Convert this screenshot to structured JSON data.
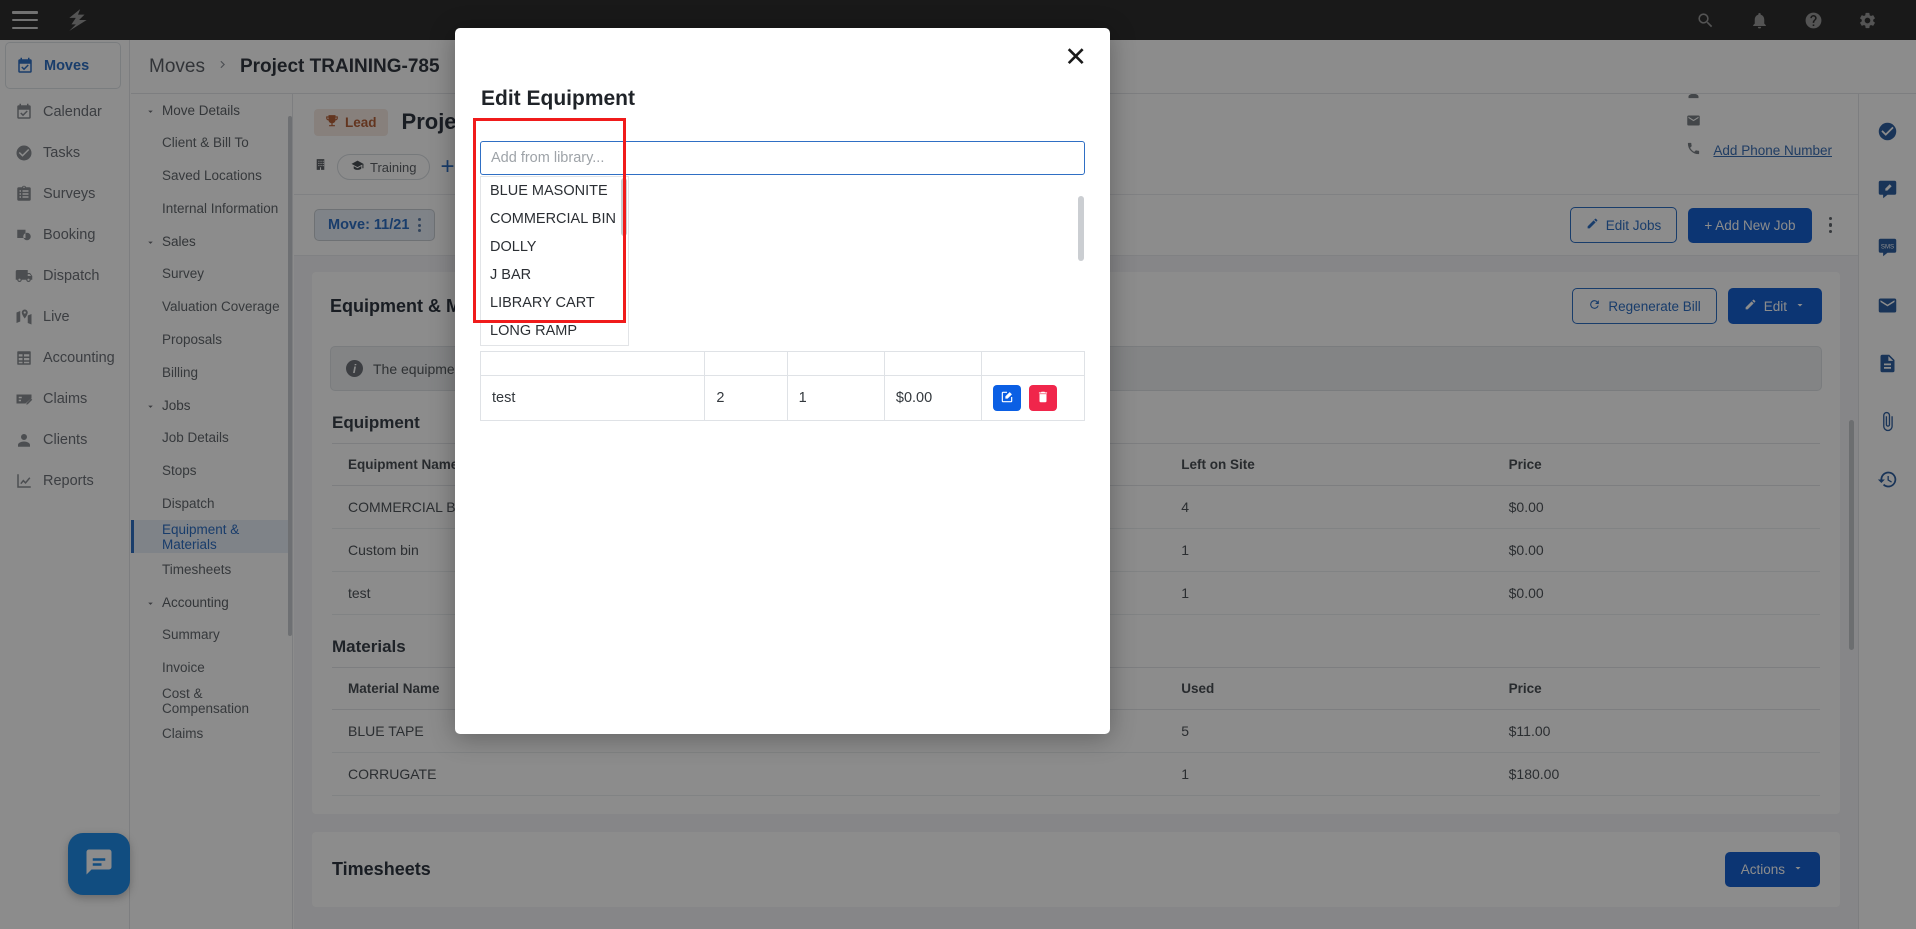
{
  "topbar": {
    "menu_icon": "hamburger-icon",
    "logo_icon": "bolt-logo",
    "icons": [
      {
        "name": "search-icon",
        "label": "Search"
      },
      {
        "name": "bell-icon",
        "label": "Notifications"
      },
      {
        "name": "help-icon",
        "label": "Help"
      },
      {
        "name": "gear-icon",
        "label": "Settings"
      }
    ]
  },
  "sidebar": {
    "items": [
      {
        "label": "Moves",
        "icon": "calendar-check-icon",
        "active": true
      },
      {
        "label": "Calendar",
        "icon": "calendar-icon",
        "active": false
      },
      {
        "label": "Tasks",
        "icon": "check-circle-icon",
        "active": false
      },
      {
        "label": "Surveys",
        "icon": "clipboard-icon",
        "active": false
      },
      {
        "label": "Booking",
        "icon": "booking-clock-icon",
        "active": false
      },
      {
        "label": "Dispatch",
        "icon": "truck-icon",
        "active": false
      },
      {
        "label": "Live",
        "icon": "map-pin-icon",
        "active": false
      },
      {
        "label": "Accounting",
        "icon": "table-grid-icon",
        "active": false
      },
      {
        "label": "Claims",
        "icon": "card-pen-icon",
        "active": false
      },
      {
        "label": "Clients",
        "icon": "person-icon",
        "active": false
      },
      {
        "label": "Reports",
        "icon": "chart-line-icon",
        "active": false
      }
    ]
  },
  "subnav": {
    "groups": [
      {
        "label": "Move Details",
        "items": [
          "Client & Bill To",
          "Saved Locations",
          "Internal Information"
        ]
      },
      {
        "label": "Sales",
        "items": [
          "Survey",
          "Valuation Coverage",
          "Proposals",
          "Billing"
        ]
      },
      {
        "label": "Jobs",
        "items": [
          "Job Details",
          "Stops",
          "Dispatch",
          "Equipment & Materials",
          "Timesheets"
        ]
      },
      {
        "label": "Accounting",
        "items": [
          "Summary",
          "Invoice",
          "Cost & Compensation",
          "Claims"
        ]
      }
    ],
    "active_item": "Equipment & Materials"
  },
  "breadcrumb": {
    "root": "Moves",
    "current": "Project TRAINING-785"
  },
  "project_header": {
    "status_badge": "Lead",
    "status_icon": "trophy-icon",
    "title": "Project T",
    "building_icon": "building-icon",
    "tag": "Training",
    "tag_icon": "graduation-cap-icon",
    "add_tag_label": "+",
    "contact_person_icon": "person-icon",
    "contact_email_icon": "envelope-icon",
    "contact_phone_icon": "phone-icon",
    "add_phone_label": "Add Phone Number"
  },
  "job_toolbar": {
    "move_pill": "Move: 11/21",
    "edit_jobs": "Edit Jobs",
    "edit_jobs_icon": "pencil-icon",
    "add_new_job": "+ Add New Job",
    "overflow_icon": "kebab-icon"
  },
  "equipment_panel": {
    "title": "Equipment & Mat",
    "regenerate_bill": "Regenerate Bill",
    "regenerate_icon": "refresh-icon",
    "edit": "Edit",
    "edit_icon": "pencil-icon",
    "edit_caret": "chevron-down-icon",
    "info_text": "The equipment &",
    "info_icon": "info-icon",
    "equipment_section_title": "Equipment",
    "equipment_columns": [
      "Equipment Name",
      "Left on Site",
      "Price"
    ],
    "equipment_rows": [
      {
        "name": "COMMERCIAL BIN",
        "left_on_site": "4",
        "price": "$0.00"
      },
      {
        "name": "Custom bin",
        "left_on_site": "1",
        "price": "$0.00"
      },
      {
        "name": "test",
        "left_on_site": "1",
        "price": "$0.00"
      }
    ],
    "materials_section_title": "Materials",
    "materials_columns": [
      "Material Name",
      "Used",
      "Price"
    ],
    "materials_rows": [
      {
        "name": "BLUE TAPE",
        "used": "5",
        "price": "$11.00"
      },
      {
        "name": "CORRUGATE",
        "used": "1",
        "price": "$180.00"
      }
    ],
    "timesheets_title": "Timesheets",
    "actions_label": "Actions",
    "actions_caret": "chevron-down-icon"
  },
  "right_rail": {
    "icons": [
      {
        "name": "task-check-icon"
      },
      {
        "name": "note-pencil-icon"
      },
      {
        "name": "sms-icon"
      },
      {
        "name": "email-icon"
      },
      {
        "name": "document-icon"
      },
      {
        "name": "attachment-icon"
      },
      {
        "name": "history-icon"
      }
    ]
  },
  "chat_widget": {
    "icon": "chat-bubble-icon"
  },
  "modal": {
    "title": "Edit Equipment",
    "close_icon": "close-icon",
    "library_input": {
      "placeholder": "Add from library...",
      "value": ""
    },
    "library_options": [
      "BLUE MASONITE",
      "COMMERCIAL BIN",
      "DOLLY",
      "J BAR",
      "LIBRARY CART",
      "LONG RAMP"
    ],
    "table_rows": [
      {
        "name": "test",
        "qty": "2",
        "left": "1",
        "price": "$0.00",
        "edit_icon": "pencil-square-icon",
        "delete_icon": "trash-icon"
      }
    ]
  },
  "colors": {
    "accent_blue": "#2f6fc4",
    "primary_button": "#1661d1",
    "delete_red": "#f0264b",
    "edit_blue": "#0b5fe4",
    "highlight_red": "#f01b1b",
    "topbar_dark": "#2e2e2e"
  }
}
